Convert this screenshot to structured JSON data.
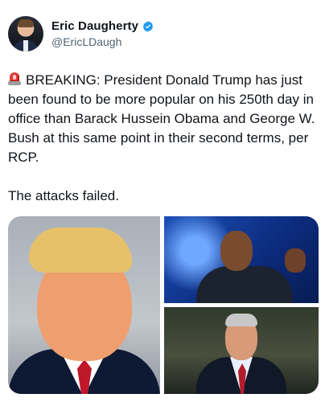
{
  "author": {
    "display_name": "Eric Daugherty",
    "handle": "@EricLDaugh",
    "verified": true,
    "avatar_icon": "avatar-icon",
    "verified_icon": "verified-badge-icon"
  },
  "tweet": {
    "emoji_icon": "police-siren-icon",
    "paragraph_1": "BREAKING: President Donald Trump has just been found to be more popular on his 250th day in office than Barack Hussein Obama and George W. Bush at this same point in their second terms, per RCP.",
    "paragraph_2": "The attacks failed."
  },
  "media": {
    "images": [
      {
        "name": "image-trump"
      },
      {
        "name": "image-obama"
      },
      {
        "name": "image-bush"
      }
    ]
  },
  "colors": {
    "verified_blue": "#1d9bf0",
    "text_primary": "#0f1419",
    "text_secondary": "#536471",
    "siren_red": "#e53935"
  }
}
